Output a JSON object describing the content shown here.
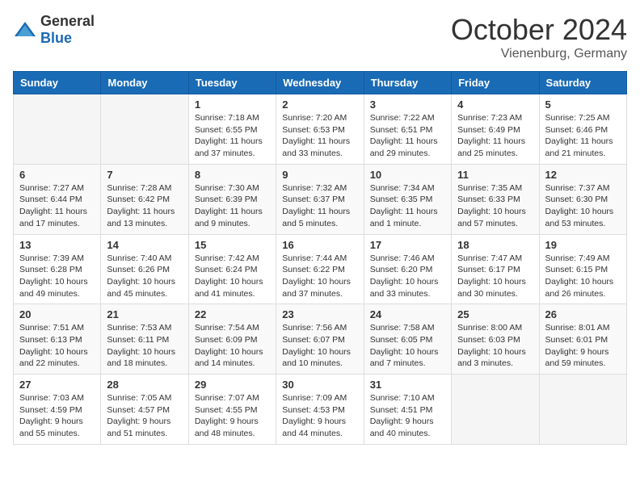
{
  "logo": {
    "text_general": "General",
    "text_blue": "Blue"
  },
  "header": {
    "month": "October 2024",
    "location": "Vienenburg, Germany"
  },
  "weekdays": [
    "Sunday",
    "Monday",
    "Tuesday",
    "Wednesday",
    "Thursday",
    "Friday",
    "Saturday"
  ],
  "weeks": [
    [
      {
        "day": "",
        "info": ""
      },
      {
        "day": "",
        "info": ""
      },
      {
        "day": "1",
        "info": "Sunrise: 7:18 AM\nSunset: 6:55 PM\nDaylight: 11 hours\nand 37 minutes."
      },
      {
        "day": "2",
        "info": "Sunrise: 7:20 AM\nSunset: 6:53 PM\nDaylight: 11 hours\nand 33 minutes."
      },
      {
        "day": "3",
        "info": "Sunrise: 7:22 AM\nSunset: 6:51 PM\nDaylight: 11 hours\nand 29 minutes."
      },
      {
        "day": "4",
        "info": "Sunrise: 7:23 AM\nSunset: 6:49 PM\nDaylight: 11 hours\nand 25 minutes."
      },
      {
        "day": "5",
        "info": "Sunrise: 7:25 AM\nSunset: 6:46 PM\nDaylight: 11 hours\nand 21 minutes."
      }
    ],
    [
      {
        "day": "6",
        "info": "Sunrise: 7:27 AM\nSunset: 6:44 PM\nDaylight: 11 hours\nand 17 minutes."
      },
      {
        "day": "7",
        "info": "Sunrise: 7:28 AM\nSunset: 6:42 PM\nDaylight: 11 hours\nand 13 minutes."
      },
      {
        "day": "8",
        "info": "Sunrise: 7:30 AM\nSunset: 6:39 PM\nDaylight: 11 hours\nand 9 minutes."
      },
      {
        "day": "9",
        "info": "Sunrise: 7:32 AM\nSunset: 6:37 PM\nDaylight: 11 hours\nand 5 minutes."
      },
      {
        "day": "10",
        "info": "Sunrise: 7:34 AM\nSunset: 6:35 PM\nDaylight: 11 hours\nand 1 minute."
      },
      {
        "day": "11",
        "info": "Sunrise: 7:35 AM\nSunset: 6:33 PM\nDaylight: 10 hours\nand 57 minutes."
      },
      {
        "day": "12",
        "info": "Sunrise: 7:37 AM\nSunset: 6:30 PM\nDaylight: 10 hours\nand 53 minutes."
      }
    ],
    [
      {
        "day": "13",
        "info": "Sunrise: 7:39 AM\nSunset: 6:28 PM\nDaylight: 10 hours\nand 49 minutes."
      },
      {
        "day": "14",
        "info": "Sunrise: 7:40 AM\nSunset: 6:26 PM\nDaylight: 10 hours\nand 45 minutes."
      },
      {
        "day": "15",
        "info": "Sunrise: 7:42 AM\nSunset: 6:24 PM\nDaylight: 10 hours\nand 41 minutes."
      },
      {
        "day": "16",
        "info": "Sunrise: 7:44 AM\nSunset: 6:22 PM\nDaylight: 10 hours\nand 37 minutes."
      },
      {
        "day": "17",
        "info": "Sunrise: 7:46 AM\nSunset: 6:20 PM\nDaylight: 10 hours\nand 33 minutes."
      },
      {
        "day": "18",
        "info": "Sunrise: 7:47 AM\nSunset: 6:17 PM\nDaylight: 10 hours\nand 30 minutes."
      },
      {
        "day": "19",
        "info": "Sunrise: 7:49 AM\nSunset: 6:15 PM\nDaylight: 10 hours\nand 26 minutes."
      }
    ],
    [
      {
        "day": "20",
        "info": "Sunrise: 7:51 AM\nSunset: 6:13 PM\nDaylight: 10 hours\nand 22 minutes."
      },
      {
        "day": "21",
        "info": "Sunrise: 7:53 AM\nSunset: 6:11 PM\nDaylight: 10 hours\nand 18 minutes."
      },
      {
        "day": "22",
        "info": "Sunrise: 7:54 AM\nSunset: 6:09 PM\nDaylight: 10 hours\nand 14 minutes."
      },
      {
        "day": "23",
        "info": "Sunrise: 7:56 AM\nSunset: 6:07 PM\nDaylight: 10 hours\nand 10 minutes."
      },
      {
        "day": "24",
        "info": "Sunrise: 7:58 AM\nSunset: 6:05 PM\nDaylight: 10 hours\nand 7 minutes."
      },
      {
        "day": "25",
        "info": "Sunrise: 8:00 AM\nSunset: 6:03 PM\nDaylight: 10 hours\nand 3 minutes."
      },
      {
        "day": "26",
        "info": "Sunrise: 8:01 AM\nSunset: 6:01 PM\nDaylight: 9 hours\nand 59 minutes."
      }
    ],
    [
      {
        "day": "27",
        "info": "Sunrise: 7:03 AM\nSunset: 4:59 PM\nDaylight: 9 hours\nand 55 minutes."
      },
      {
        "day": "28",
        "info": "Sunrise: 7:05 AM\nSunset: 4:57 PM\nDaylight: 9 hours\nand 51 minutes."
      },
      {
        "day": "29",
        "info": "Sunrise: 7:07 AM\nSunset: 4:55 PM\nDaylight: 9 hours\nand 48 minutes."
      },
      {
        "day": "30",
        "info": "Sunrise: 7:09 AM\nSunset: 4:53 PM\nDaylight: 9 hours\nand 44 minutes."
      },
      {
        "day": "31",
        "info": "Sunrise: 7:10 AM\nSunset: 4:51 PM\nDaylight: 9 hours\nand 40 minutes."
      },
      {
        "day": "",
        "info": ""
      },
      {
        "day": "",
        "info": ""
      }
    ]
  ]
}
